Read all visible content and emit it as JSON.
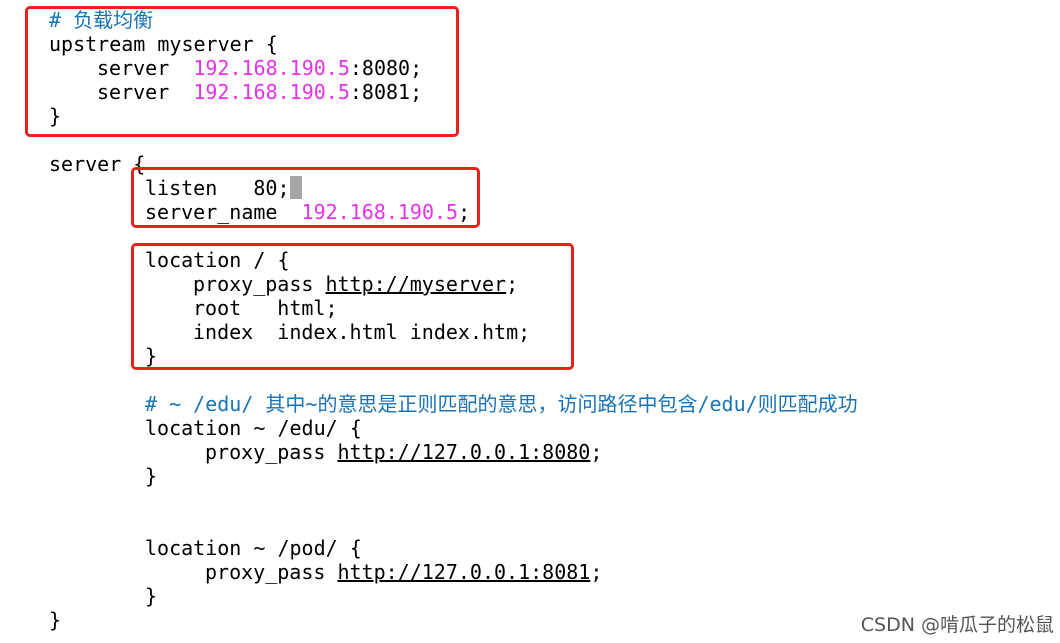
{
  "config": {
    "comment_lb": "# 负载均衡",
    "upstream_open": "upstream myserver {",
    "upstream_servers": [
      {
        "key": "server",
        "ip": "192.168.190.5",
        "port": ":8080;"
      },
      {
        "key": "server",
        "ip": "192.168.190.5",
        "port": ":8081;"
      }
    ],
    "close_brace": "}",
    "server_open": "server {",
    "listen_text": "listen   80;",
    "server_name_key": "server_name",
    "server_name_ip": "192.168.190.5",
    "server_name_end": ";",
    "location_root_open": "location / {",
    "proxy_pass_key": "proxy_pass",
    "proxy_pass_myserver_url": "http://myserver",
    "semicolon": ";",
    "root_line": "root   html;",
    "index_line": "index  index.html index.htm;",
    "comment_edu": "# ~ /edu/ 其中~的意思是正则匹配的意思，访问路径中包含/edu/则匹配成功",
    "location_edu_open": "location ~ /edu/ {",
    "proxy_pass_edu_url": "http://127.0.0.1:8080",
    "location_pod_open": "location ~ /pod/ {",
    "proxy_pass_pod_url": "http://127.0.0.1:8081"
  },
  "watermark": "CSDN @啃瓜子的松鼠",
  "colors": {
    "highlight_box": "#e8221b",
    "comment": "#1a73b5",
    "ip_literal": "#e533e5",
    "cursor": "#a6a6a6"
  }
}
